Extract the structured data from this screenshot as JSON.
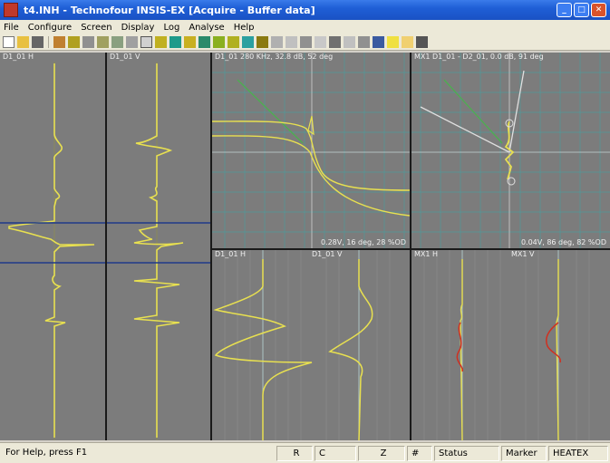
{
  "window": {
    "title": "t4.INH - Technofour INSIS-EX  [Acquire - Buffer data]",
    "buttons": [
      "minimize",
      "maximize",
      "close"
    ]
  },
  "menu": [
    "File",
    "Configure",
    "Screen",
    "Display",
    "Log",
    "Analyse",
    "Help"
  ],
  "panels": {
    "strip_h": {
      "label": "D1_01  H"
    },
    "strip_v": {
      "label": "D1_01  V"
    },
    "lissajous1": {
      "label": "D1_01  280 KHz, 32.8 dB,  52 deg",
      "readout": "0.28V,   16 deg,   28 %OD"
    },
    "lissajous2": {
      "label": "MX1  D1_01 - D2_01, 0.0 dB,  91 deg",
      "readout": "0.04V,   86 deg,   82 %OD"
    },
    "zoom1": {
      "label_h": "D1_01  H",
      "label_v": "D1_01  V"
    },
    "zoom2": {
      "label_h": "MX1  H",
      "label_v": "MX1  V"
    }
  },
  "colors": {
    "signal": "#e8e050",
    "green_line": "#4caf50",
    "white_line": "#e0e0e0",
    "grid": "#4f9a9a",
    "marker": "#1e3a8a",
    "red_signal": "#d03020"
  },
  "statusbar": {
    "help": "For Help, press F1",
    "cells": [
      "R",
      "C",
      "Z",
      "#",
      "Status",
      "Marker",
      "HEATEX"
    ]
  }
}
